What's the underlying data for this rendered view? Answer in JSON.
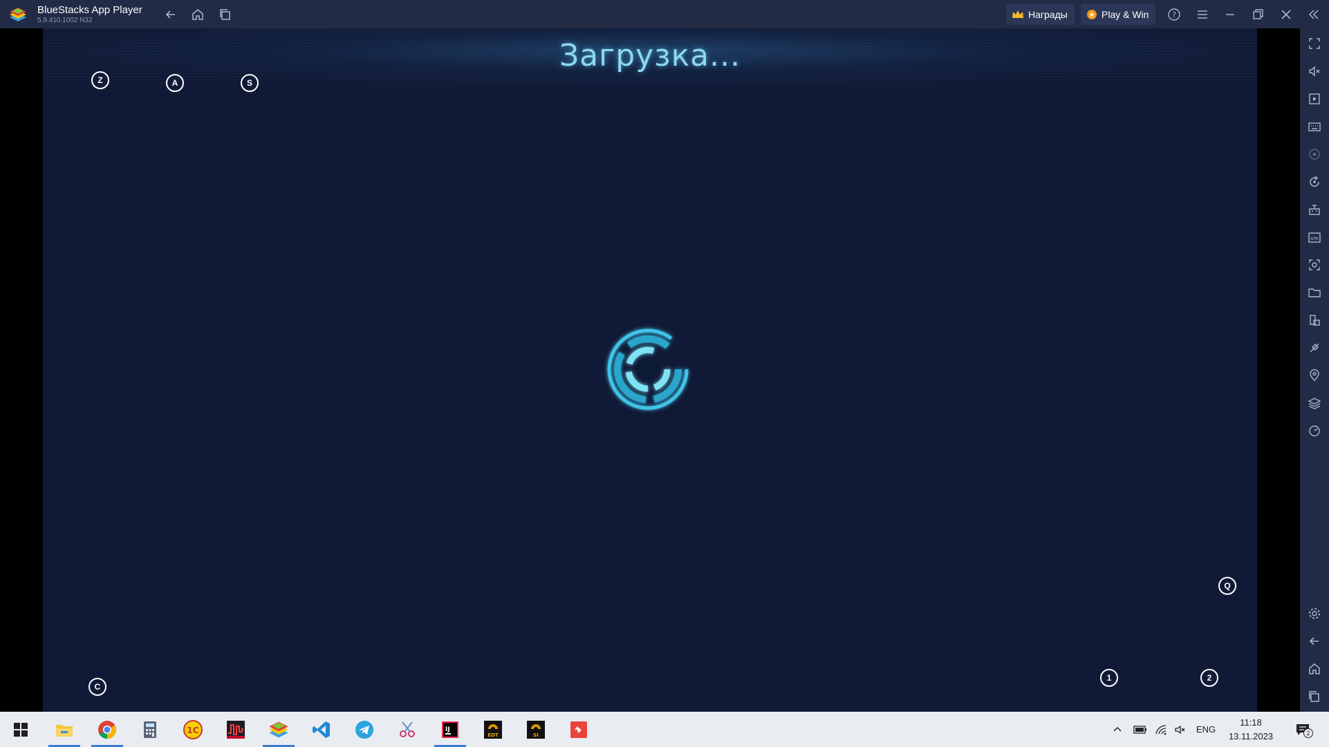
{
  "titlebar": {
    "app_title": "BlueStacks App Player",
    "version": "5.9.410.1002  N32",
    "rewards_label": "Награды",
    "playwin_label": "Play & Win",
    "icons": [
      "back-icon",
      "home-icon",
      "recent-apps-icon",
      "help-icon",
      "menu-icon",
      "minimize-icon",
      "restore-icon",
      "close-icon",
      "collapse-sidebar-icon"
    ]
  },
  "screen": {
    "loading_text": "Загрузка...",
    "key_hints": [
      "Z",
      "A",
      "S",
      "Q",
      "C",
      "1",
      "2"
    ]
  },
  "sidebar": {
    "icons": [
      "fullscreen-icon",
      "volume-icon",
      "media-icon",
      "keyboard-icon",
      "record-icon",
      "rotate-icon",
      "macro-icon",
      "apk-icon",
      "screenshot-icon",
      "folder-icon",
      "multi-instance-icon",
      "eco-mode-icon",
      "location-icon",
      "layers-icon",
      "performance-icon",
      "settings-icon",
      "android-back-icon",
      "android-home-icon",
      "android-recents-icon"
    ]
  },
  "taskbar": {
    "apps": [
      "start",
      "file-explorer",
      "chrome",
      "calculator",
      "onec",
      "monitor",
      "bluestacks",
      "vscode",
      "telegram",
      "scissors",
      "intellij",
      "edt",
      "si",
      "git"
    ],
    "tray_language": "ENG",
    "time": "11:18",
    "date": "13.11.2023",
    "notifications_count": "2"
  },
  "colors": {
    "titlebar_bg": "#222b45",
    "screen_bg": "#101a36",
    "accent_cyan": "#5fd3ee",
    "taskbar_bg": "#e9ecf1"
  }
}
